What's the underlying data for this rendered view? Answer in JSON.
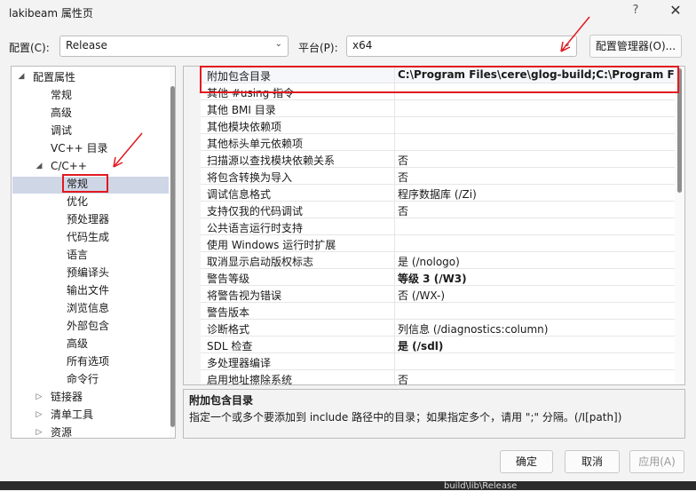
{
  "window": {
    "title": "lakibeam 属性页",
    "help": "?",
    "close": "✕"
  },
  "config": {
    "config_label": "配置(C):",
    "config_value": "Release",
    "platform_label": "平台(P):",
    "platform_value": "x64",
    "manager_button": "配置管理器(O)..."
  },
  "tree": {
    "root": "配置属性",
    "general": "常规",
    "advanced": "高级",
    "debug": "调试",
    "vcpp_dirs": "VC++ 目录",
    "cpp": "C/C++",
    "cpp_children": [
      "常规",
      "优化",
      "预处理器",
      "代码生成",
      "语言",
      "预编译头",
      "输出文件",
      "浏览信息",
      "外部包含",
      "高级",
      "所有选项",
      "命令行"
    ],
    "linker": "链接器",
    "manifest": "清单工具",
    "resources": "资源"
  },
  "grid": {
    "rows": [
      {
        "name": "附加包含目录",
        "value": "C:\\Program Files\\cere\\glog-build;C:\\Program Files",
        "bold": true
      },
      {
        "name": "其他 #using 指令",
        "value": "",
        "bold": false
      },
      {
        "name": "其他 BMI 目录",
        "value": "",
        "bold": false
      },
      {
        "name": "其他模块依赖项",
        "value": "",
        "bold": false
      },
      {
        "name": "其他标头单元依赖项",
        "value": "",
        "bold": false
      },
      {
        "name": "扫描源以查找模块依赖关系",
        "value": "否",
        "bold": false
      },
      {
        "name": "将包含转换为导入",
        "value": "否",
        "bold": false
      },
      {
        "name": "调试信息格式",
        "value": "程序数据库 (/Zi)",
        "bold": false
      },
      {
        "name": "支持仅我的代码调试",
        "value": "否",
        "bold": false
      },
      {
        "name": "公共语言运行时支持",
        "value": "",
        "bold": false
      },
      {
        "name": "使用 Windows 运行时扩展",
        "value": "",
        "bold": false
      },
      {
        "name": "取消显示启动版权标志",
        "value": "是 (/nologo)",
        "bold": false
      },
      {
        "name": "警告等级",
        "value": "等级 3 (/W3)",
        "bold": true
      },
      {
        "name": "将警告视为错误",
        "value": "否 (/WX-)",
        "bold": false
      },
      {
        "name": "警告版本",
        "value": "",
        "bold": false
      },
      {
        "name": "诊断格式",
        "value": "列信息 (/diagnostics:column)",
        "bold": false
      },
      {
        "name": "SDL 检查",
        "value": "是 (/sdl)",
        "bold": true
      },
      {
        "name": "多处理器编译",
        "value": "",
        "bold": false
      },
      {
        "name": "启用地址擦除系统",
        "value": "否",
        "bold": false
      }
    ]
  },
  "description": {
    "title": "附加包含目录",
    "body": "指定一个或多个要添加到 include 路径中的目录；如果指定多个，请用 \";\" 分隔。(/I[path])"
  },
  "buttons": {
    "ok": "确定",
    "cancel": "取消",
    "apply": "应用(A)"
  },
  "background_text": "build\\lib\\Release",
  "colors": {
    "annotation_red": "#e2191f",
    "selection": "#cfd6e6"
  }
}
